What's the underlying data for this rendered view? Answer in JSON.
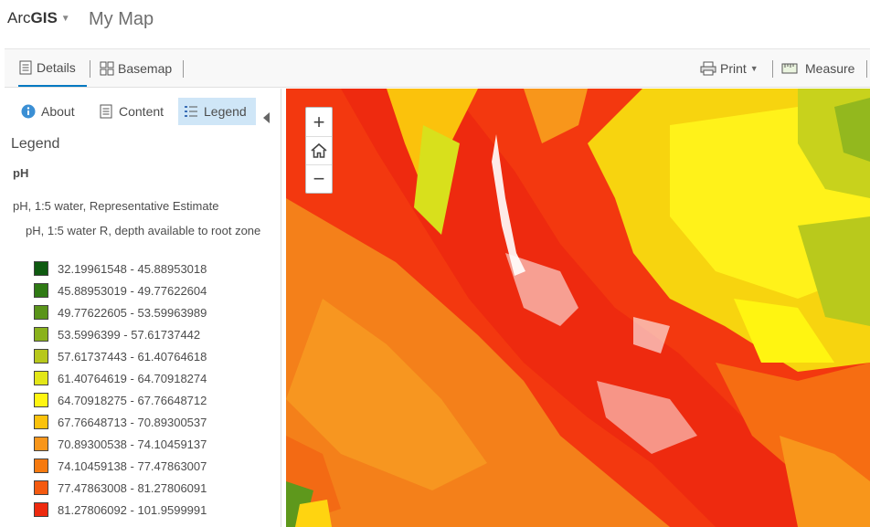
{
  "header": {
    "brand_prefix": "Arc",
    "brand_bold": "GIS",
    "brand_caret": "▼",
    "map_title": "My Map"
  },
  "toolbar": {
    "details": "Details",
    "basemap": "Basemap",
    "print": "Print",
    "print_caret": "▼",
    "measure": "Measure"
  },
  "panel": {
    "tabs": {
      "about": "About",
      "content": "Content",
      "legend": "Legend"
    },
    "legend_heading": "Legend",
    "layer_title": "pH",
    "sub_title": "pH, 1:5 water, Representative Estimate",
    "field_title": "pH, 1:5 water R, depth available to root zone",
    "items": [
      {
        "label": "32.19961548 - 45.88953018",
        "color": "#0e5a10"
      },
      {
        "label": "45.88953019 - 49.77622604",
        "color": "#2f7a14"
      },
      {
        "label": "49.77622605 - 53.59963989",
        "color": "#5a941a"
      },
      {
        "label": "53.5996399 - 57.61737442",
        "color": "#8ab21c"
      },
      {
        "label": "57.61737443 - 61.40764618",
        "color": "#b7c81c"
      },
      {
        "label": "61.40764619 - 64.70918274",
        "color": "#e2e618"
      },
      {
        "label": "64.70918275 - 67.76648712",
        "color": "#fff511"
      },
      {
        "label": "67.76648713 - 70.89300537",
        "color": "#fbc20c"
      },
      {
        "label": "70.89300538 - 74.10459137",
        "color": "#f8961b"
      },
      {
        "label": "74.10459138 - 77.47863007",
        "color": "#f67a0f"
      },
      {
        "label": "77.47863008 - 81.27806091",
        "color": "#f45a10"
      },
      {
        "label": "81.27806092 - 101.9599991",
        "color": "#ee2a0f"
      }
    ]
  },
  "map": {
    "zoom_in": "+",
    "zoom_out": "−"
  }
}
